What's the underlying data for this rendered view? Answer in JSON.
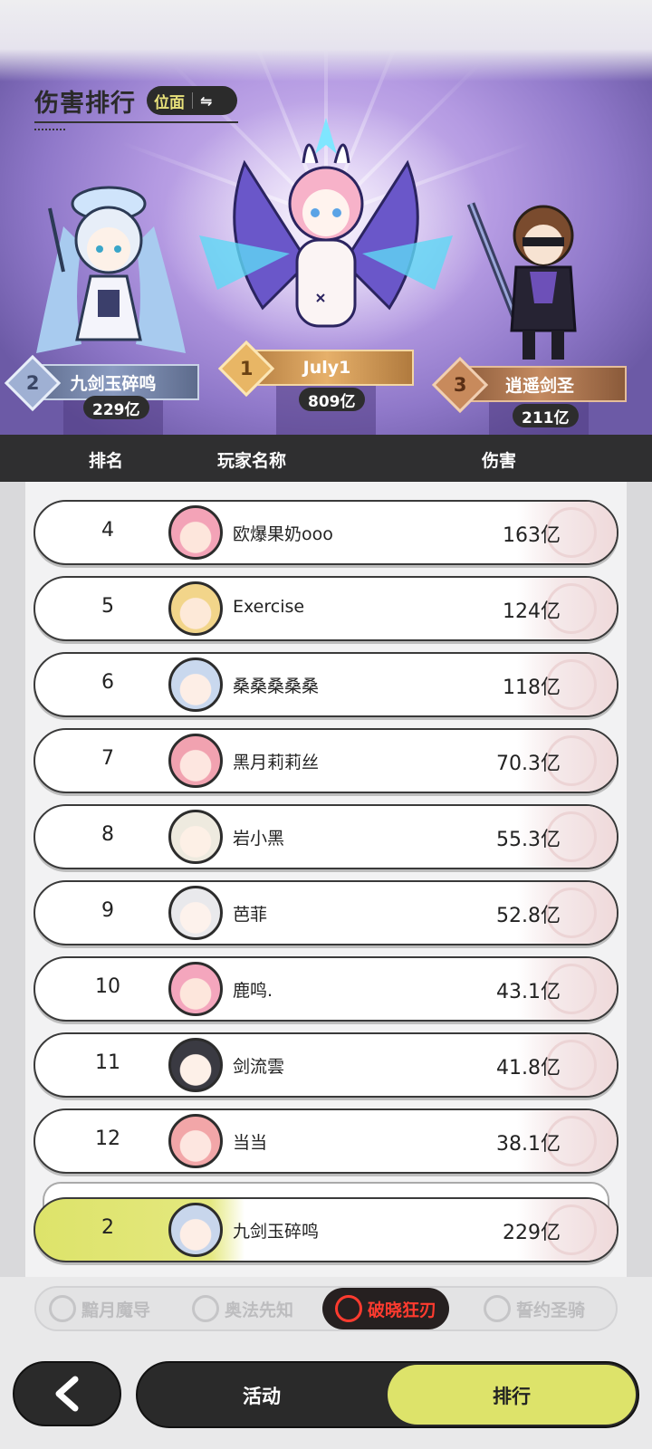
{
  "header": {
    "title": "伤害排行",
    "toggle_label": "位面",
    "toggle_icon": "swap-icon"
  },
  "podium": [
    {
      "rank": "1",
      "name": "July1",
      "damage": "809亿"
    },
    {
      "rank": "2",
      "name": "九剑玉碎鸣",
      "damage": "229亿"
    },
    {
      "rank": "3",
      "name": "逍遥剑圣",
      "damage": "211亿"
    }
  ],
  "table": {
    "columns": [
      "排名",
      "玩家名称",
      "伤害"
    ],
    "rows": [
      {
        "rank": "4",
        "name": "欧爆果奶ooo",
        "damage": "163亿"
      },
      {
        "rank": "5",
        "name": "Exercise",
        "damage": "124亿"
      },
      {
        "rank": "6",
        "name": "桑桑桑桑桑",
        "damage": "118亿"
      },
      {
        "rank": "7",
        "name": "黑月莉莉丝",
        "damage": "70.3亿"
      },
      {
        "rank": "8",
        "name": "岩小黑",
        "damage": "55.3亿"
      },
      {
        "rank": "9",
        "name": "芭菲",
        "damage": "52.8亿"
      },
      {
        "rank": "10",
        "name": "鹿鸣.",
        "damage": "43.1亿"
      },
      {
        "rank": "11",
        "name": "剑流雲",
        "damage": "41.8亿"
      },
      {
        "rank": "12",
        "name": "当当",
        "damage": "38.1亿"
      }
    ],
    "self_row": {
      "rank": "2",
      "name": "九剑玉碎鸣",
      "damage": "229亿"
    }
  },
  "factions": [
    {
      "label": "黯月魔导",
      "active": false
    },
    {
      "label": "奥法先知",
      "active": false
    },
    {
      "label": "破晓狂刃",
      "active": true
    },
    {
      "label": "誓约圣骑",
      "active": false
    }
  ],
  "bottom_nav": {
    "back_icon": "chevron-left-icon",
    "activity_label": "活动",
    "ranking_label": "排行"
  },
  "colors": {
    "accent_yellow": "#dde36a",
    "dark": "#2a2a2a",
    "active_faction_red": "#ff3b2f"
  }
}
